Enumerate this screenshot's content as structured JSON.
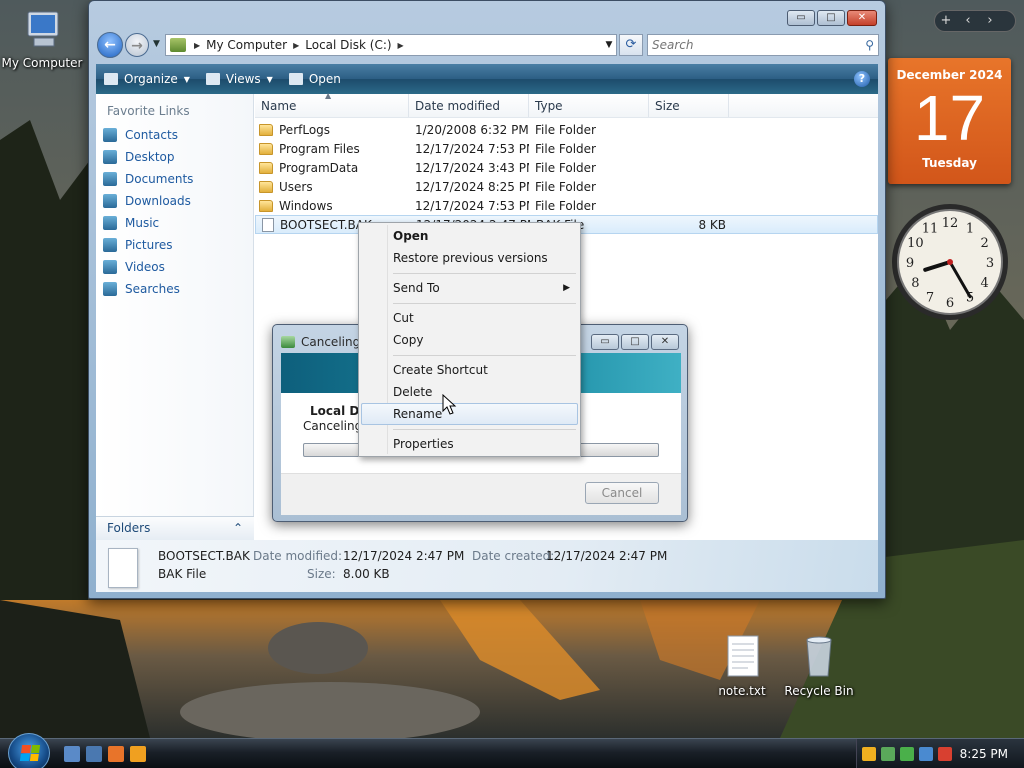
{
  "desktop": {
    "icons": [
      {
        "label": "My Computer"
      },
      {
        "label": "note.txt"
      },
      {
        "label": "Recycle Bin"
      }
    ]
  },
  "sidebar": {
    "controls": [
      "+",
      "‹",
      "›"
    ],
    "calendar": {
      "month": "December 2024",
      "day": "17",
      "weekday": "Tuesday"
    },
    "clock": {
      "hour": 8,
      "minute": 25
    }
  },
  "explorer": {
    "window_buttons": [
      "▭",
      "□",
      "✕"
    ],
    "address": {
      "crumbs": [
        "My Computer",
        "Local Disk (C:)"
      ]
    },
    "search": {
      "placeholder": "Search"
    },
    "toolbar": {
      "organize": "Organize",
      "views": "Views",
      "open": "Open",
      "help": "?"
    },
    "nav_pane": {
      "heading": "Favorite Links",
      "links": [
        "Contacts",
        "Desktop",
        "Documents",
        "Downloads",
        "Music",
        "Pictures",
        "Videos",
        "Searches"
      ],
      "folders_label": "Folders",
      "folders_chevron": "⌃"
    },
    "columns": [
      "Name",
      "Date modified",
      "Type",
      "Size"
    ],
    "files": [
      {
        "name": "PerfLogs",
        "date": "1/20/2008 6:32 PM",
        "type": "File Folder",
        "size": "",
        "kind": "folder"
      },
      {
        "name": "Program Files",
        "date": "12/17/2024 7:53 PM",
        "type": "File Folder",
        "size": "",
        "kind": "folder"
      },
      {
        "name": "ProgramData",
        "date": "12/17/2024 3:43 PM",
        "type": "File Folder",
        "size": "",
        "kind": "folder"
      },
      {
        "name": "Users",
        "date": "12/17/2024 8:25 PM",
        "type": "File Folder",
        "size": "",
        "kind": "folder"
      },
      {
        "name": "Windows",
        "date": "12/17/2024 7:53 PM",
        "type": "File Folder",
        "size": "",
        "kind": "folder"
      },
      {
        "name": "BOOTSECT.BAK",
        "date": "12/17/2024 2:47 PM",
        "type": "BAK File",
        "size": "8 KB",
        "kind": "file",
        "selected": true
      }
    ],
    "details": {
      "filename": "BOOTSECT.BAK",
      "filetype": "BAK File",
      "modified_label": "Date modified:",
      "modified_value": "12/17/2024 2:47 PM",
      "created_label": "Date created:",
      "created_value": "12/17/2024 2:47 PM",
      "size_label": "Size:",
      "size_value": "8.00 KB"
    }
  },
  "dialog": {
    "title": "Canceling...",
    "location": "Local Disk (C:)",
    "status": "Canceling...",
    "progress": 0,
    "cancel_label": "Cancel",
    "buttons": [
      "▭",
      "□",
      "✕"
    ]
  },
  "context_menu": {
    "groups": [
      [
        {
          "label": "Open",
          "bold": true
        },
        {
          "label": "Restore previous versions"
        }
      ],
      [
        {
          "label": "Send To",
          "submenu": true
        }
      ],
      [
        {
          "label": "Cut"
        },
        {
          "label": "Copy"
        }
      ],
      [
        {
          "label": "Create Shortcut"
        },
        {
          "label": "Delete"
        },
        {
          "label": "Rename",
          "hover": true
        }
      ],
      [
        {
          "label": "Properties"
        }
      ]
    ],
    "submenu_arrow": "▶"
  },
  "taskbar": {
    "time": "8:25 PM",
    "quick_launch": [
      {
        "icon": "show-desktop-icon",
        "color": "#5a8ac8"
      },
      {
        "icon": "switch-windows-icon",
        "color": "#4a78b0"
      },
      {
        "icon": "firefox-icon",
        "color": "#e8742a"
      },
      {
        "icon": "media-player-icon",
        "color": "#f0a020"
      }
    ],
    "tray_icons": [
      {
        "icon": "security-shield-icon",
        "color": "#f0b020"
      },
      {
        "icon": "sync-icon",
        "color": "#5aa85a"
      },
      {
        "icon": "network-status-icon",
        "color": "#4ab04a"
      },
      {
        "icon": "network-icon",
        "color": "#4a8ad0"
      },
      {
        "icon": "volume-muted-icon",
        "color": "#d84030"
      }
    ]
  },
  "colors": {
    "accent": "#2c5e84",
    "calendar": "#e0601f",
    "selection": "#d9ecfb"
  }
}
